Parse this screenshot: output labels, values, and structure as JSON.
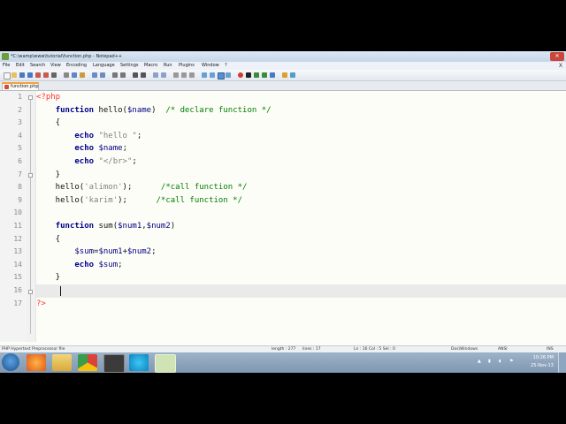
{
  "window": {
    "title": "*C:\\wamp\\www\\tutorial\\function.php - Notepad++",
    "close_glyph": "✕"
  },
  "menu": {
    "items": [
      "File",
      "Edit",
      "Search",
      "View",
      "Encoding",
      "Language",
      "Settings",
      "Macro",
      "Run",
      "Plugins",
      "Window",
      "?"
    ],
    "close_glyph": "X"
  },
  "tab": {
    "label": "function.php"
  },
  "editor": {
    "lines": [
      {
        "n": "1",
        "text": "<?php"
      },
      {
        "n": "2",
        "text": "    function hello($name)  /* declare function */"
      },
      {
        "n": "3",
        "text": "    {"
      },
      {
        "n": "4",
        "text": "        echo \"hello \";"
      },
      {
        "n": "5",
        "text": "        echo $name;"
      },
      {
        "n": "6",
        "text": "        echo \"</br>\";"
      },
      {
        "n": "7",
        "text": "    }"
      },
      {
        "n": "8",
        "text": "    hello('alimon');      /*call function */"
      },
      {
        "n": "9",
        "text": "    hello('karim');      /*call function */"
      },
      {
        "n": "10",
        "text": ""
      },
      {
        "n": "11",
        "text": "    function sum($num1,$num2)"
      },
      {
        "n": "12",
        "text": "    {"
      },
      {
        "n": "13",
        "text": "        $sum=$num1+$num2;"
      },
      {
        "n": "14",
        "text": "        echo $sum;"
      },
      {
        "n": "15",
        "text": "    }"
      },
      {
        "n": "16",
        "text": ""
      },
      {
        "n": "17",
        "text": "?>"
      }
    ],
    "current_line": 16
  },
  "status": {
    "file_type": "PHP Hypertext Preprocessor file",
    "length": "length : 277",
    "lines": "lines : 17",
    "position": "Ln : 16   Col : 5   Sel : 0",
    "eol": "Dos\\Windows",
    "encoding": "ANSI",
    "mode": "INS"
  },
  "taskbar": {
    "clock_time": "10:26 PM",
    "clock_date": "25-Nov-13"
  },
  "colors": {
    "keyword": "#00008b",
    "string": "#808080",
    "variable": "#000080",
    "comment": "#008000",
    "php_tag": "#ff3333"
  }
}
